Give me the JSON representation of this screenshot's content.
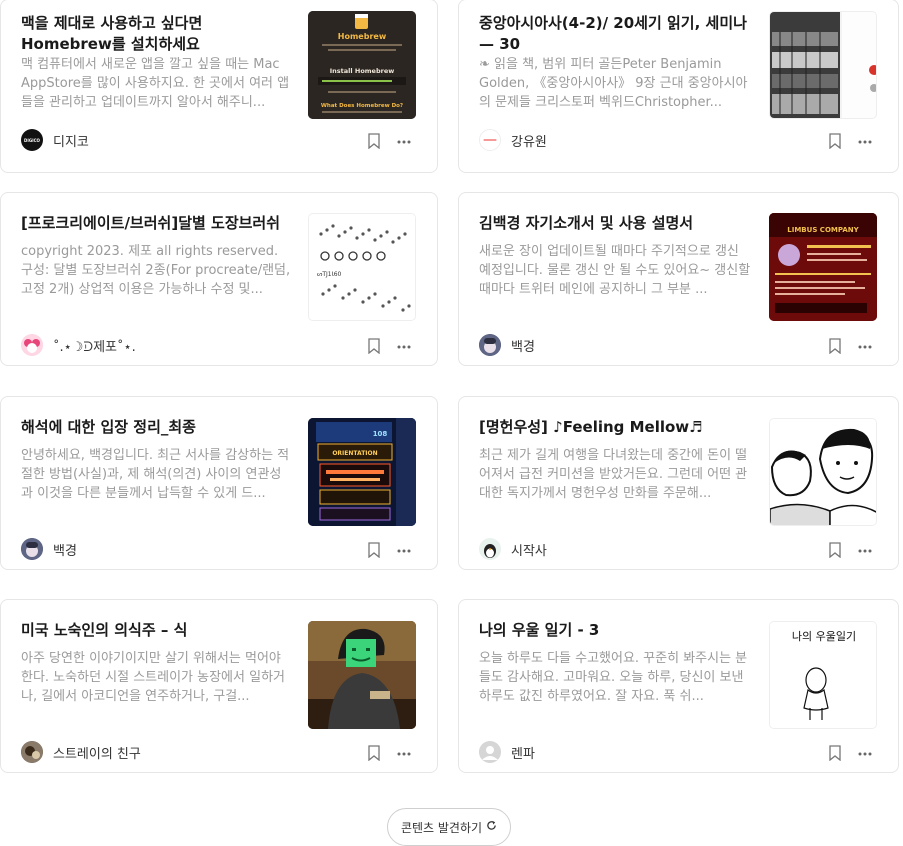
{
  "cards": [
    {
      "title": "맥을 제대로 사용하고 싶다면 Homebrew를 설치하세요",
      "desc": "맥 컴퓨터에서 새로운 앱을 깔고 싶을 때는 Mac AppStore를 많이 사용하지요. 한 곳에서 여러 앱들을 관리하고 업데이트까지 알아서 해주니...",
      "author": "디지코",
      "avatar_text": "DIGICO",
      "thumb": {
        "t1": "Homebrew",
        "t2": "Install Homebrew",
        "t3": "What Does Homebrew Do?"
      }
    },
    {
      "title": "중앙아시아사(4-2)/ 20세기 읽기, 세미나 — 30",
      "desc": "❧ 읽을 책, 범위 피터 골든Peter Benjamin Golden, 《중앙아시아사》 9장 근대 중앙아시아의 문제들 크리스토퍼 벡위드Christopher...",
      "author": "강유원"
    },
    {
      "title": "[프로크리에이트/브러쉬]달별 도장브러쉬",
      "desc": "copyright 2023. 제포 all rights reserved. 구성: 달별 도장브러쉬 2종(For procreate/랜덤, 고정 2개) 상업적 이용은 가능하나 수정 및...",
      "author": "˚.⋆☽ᑓ제포˚⋆."
    },
    {
      "title": "김백경 자기소개서 및 사용 설명서",
      "desc": "새로운 장이 업데이트될 때마다 주기적으로 갱신 예정입니다. 물론 갱신 안 될 수도 있어요~ 갱신할 때마다 트위터 메인에 공지하니 그 부분 ...",
      "author": "백경",
      "thumb": {
        "t1": "LIMBUS COMPANY"
      }
    },
    {
      "title": "해석에 대한 입장 정리_최종",
      "desc": "안녕하세요, 백경입니다. 최근 서사를 감상하는 적절한 방법(사실)과, 제 해석(의견) 사이의 연관성과 이것을 다른 분들께서 납득할 수 있게 드...",
      "author": "백경",
      "thumb": {
        "t1": "ORIENTATION",
        "t2": "108"
      }
    },
    {
      "title": "[명헌우성] ♪Feeling Mellow♬",
      "desc": "최근 제가 길게 여행을 다녀왔는데 중간에 돈이 떨어져서 급전 커미션을 받았거든요. 그런데 어떤 관대한 독지가께서 명헌우성 만화를 주문해...",
      "author": "시작사"
    },
    {
      "title": "미국 노숙인의 의식주 – 식",
      "desc": "아주 당연한 이야기이지만 살기 위해서는 먹어야 한다. 노숙하던 시절 스트레이가 농장에서 일하거나, 길에서 아코디언을 연주하거나, 구걸...",
      "author": "스트레이의 친구"
    },
    {
      "title": "나의 우울 일기 - 3",
      "desc": "오늘 하루도 다들 수고했어요. 꾸준히 봐주시는 분들도 감사해요. 고마워요. 오늘 하루, 당신이 보낸 하루도 값진 하루였어요. 잘 자요. 푹 쉬...",
      "author": "렌파",
      "thumb": {
        "t1": "나의 우울일기"
      }
    }
  ],
  "discover_label": "콘텐츠 발견하기",
  "icons": {
    "bookmark": "bookmark-icon",
    "more": "more-dots-icon",
    "refresh": "refresh-icon"
  }
}
